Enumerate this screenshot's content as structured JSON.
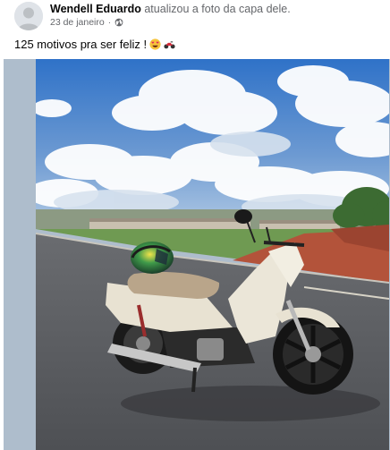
{
  "post": {
    "author": "Wendell Eduardo",
    "action": "atualizou a foto da capa dele.",
    "date": "23 de janeiro",
    "separator": "·",
    "audience_icon": "globe-icon",
    "caption": "125 motivos pra ser feliz !",
    "caption_emojis": [
      "heart-eyes-emoji",
      "motorcycle-emoji"
    ]
  },
  "photo": {
    "subject": "cover-photo",
    "colors": {
      "sky_top": "#2f72c8",
      "sky_bottom": "#8fb5de",
      "road": "#5b5d62",
      "bike_body": "#e8e2d2",
      "seat": "#b9a58a",
      "frame_bg": "#aebdcc"
    }
  }
}
